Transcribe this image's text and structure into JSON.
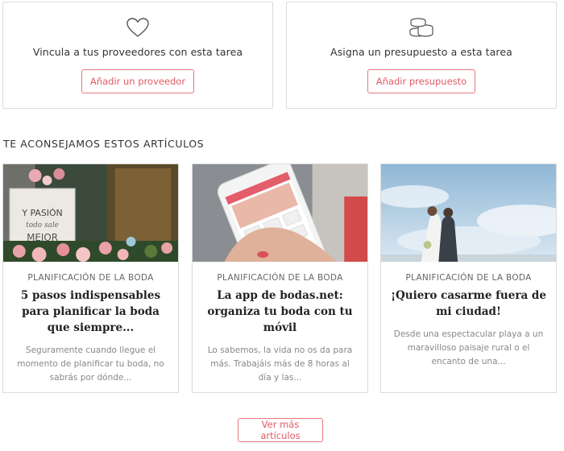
{
  "tasks": [
    {
      "icon": "heart-icon",
      "text": "Vincula a tus proveedores con esta tarea",
      "button": "Añadir un proveedor"
    },
    {
      "icon": "coins-icon",
      "text": "Asigna un presupuesto a esta tarea",
      "button": "Añadir presupuesto"
    }
  ],
  "section_title": "TE ACONSEJAMOS ESTOS ARTÍCULOS",
  "articles": [
    {
      "category": "PLANIFICACIÓN DE LA BODA",
      "title": "5 pasos indispensables para planificar la boda que siempre...",
      "excerpt": "Seguramente cuando llegue el momento de planificar tu boda, no sabrás por dónde...",
      "image_text": [
        "Y PASIÓN",
        "todo sale",
        "MEJOR"
      ]
    },
    {
      "category": "PLANIFICACIÓN DE LA BODA",
      "title": "La app de bodas.net: organiza tu boda con tu móvil",
      "excerpt": "Lo sabemos, la vida no os da para más. Trabajáis más de 8 horas al día y las..."
    },
    {
      "category": "PLANIFICACIÓN DE LA BODA",
      "title": "¡Quiero casarme fuera de mi ciudad!",
      "excerpt": "Desde una espectacular playa a un maravilloso paisaje rural o el encanto de una..."
    }
  ],
  "more_button": "Ver más artículos",
  "colors": {
    "accent": "#e05a63",
    "border": "#dcdcdc"
  }
}
